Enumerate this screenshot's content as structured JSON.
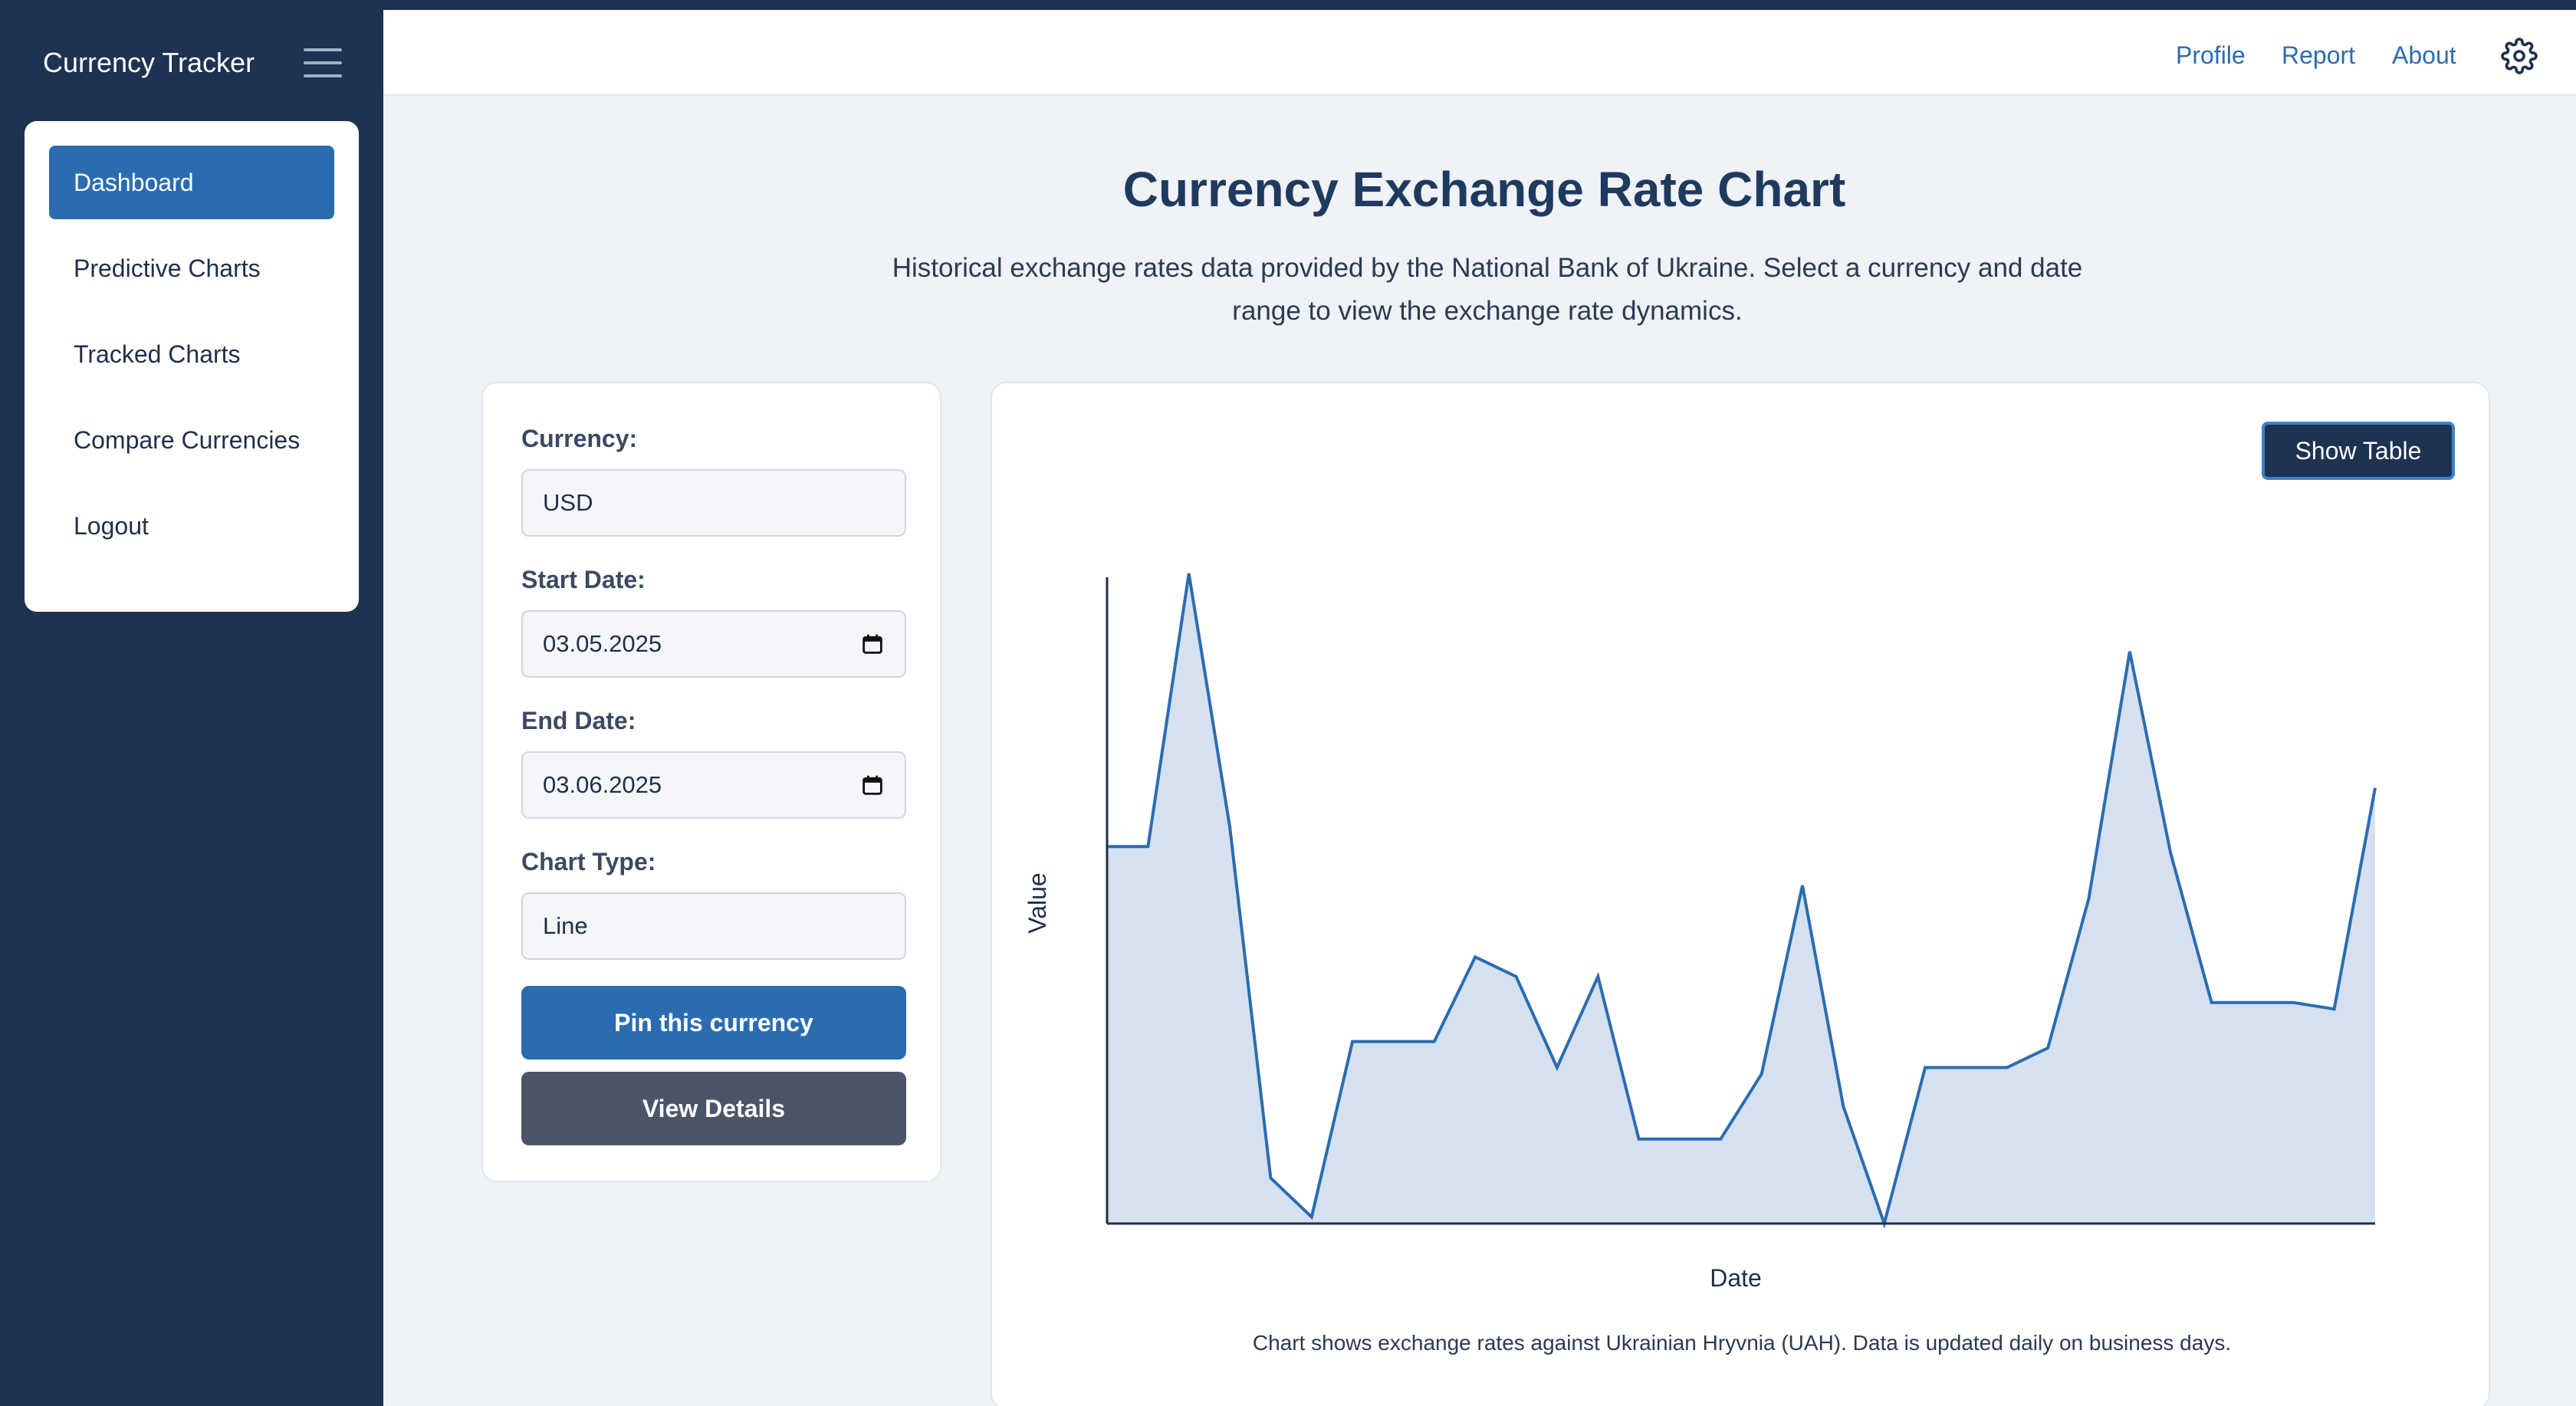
{
  "app": {
    "title": "Currency Tracker"
  },
  "sidebar": {
    "items": [
      {
        "label": "Dashboard",
        "active": true
      },
      {
        "label": "Predictive Charts",
        "active": false
      },
      {
        "label": "Tracked Charts",
        "active": false
      },
      {
        "label": "Compare Currencies",
        "active": false
      },
      {
        "label": "Logout",
        "active": false
      }
    ]
  },
  "header": {
    "links": {
      "profile": "Profile",
      "report": "Report",
      "about": "About"
    },
    "settings_icon": "gear-icon"
  },
  "main": {
    "title": "Currency Exchange Rate Chart",
    "description": "Historical exchange rates data provided by the National Bank of Ukraine. Select a currency and date range to view the exchange rate dynamics."
  },
  "controls": {
    "currency_label": "Currency:",
    "currency_value": "USD",
    "start_label": "Start Date:",
    "start_value": "03.05.2025",
    "end_label": "End Date:",
    "end_value": "03.06.2025",
    "chart_type_label": "Chart Type:",
    "chart_type_value": "Line",
    "pin_button": "Pin this currency",
    "view_button": "View Details"
  },
  "chart": {
    "show_table_button": "Show Table",
    "note": "Chart shows exchange rates against Ukrainian Hryvnia (UAH). Data is updated daily on business days."
  },
  "colors": {
    "sidebar_bg": "#1e3252",
    "accent": "#2b6cb0",
    "secondary_button": "#4a5568",
    "line": "#2b6cb0",
    "area_fill": "#d5e1ef"
  },
  "chart_data": {
    "type": "area",
    "title": "",
    "xlabel": "Date",
    "ylabel": "Value",
    "grid": false,
    "legend": "none",
    "x_ticks_shown": false,
    "y_ticks_shown": false,
    "ylim": [
      0,
      100
    ],
    "x": [
      1,
      2,
      3,
      4,
      5,
      6,
      7,
      8,
      9,
      10,
      11,
      12,
      13,
      14,
      15,
      16,
      17,
      18,
      19,
      20,
      21,
      22,
      23,
      24,
      25,
      26,
      27,
      28,
      29,
      30,
      31,
      32
    ],
    "series": [
      {
        "values": [
          58,
          58,
          100,
          61,
          7,
          1,
          28,
          28,
          28,
          41,
          38,
          24,
          38,
          13,
          13,
          13,
          23,
          52,
          18,
          0,
          24,
          24,
          24,
          27,
          50,
          88,
          57,
          34,
          34,
          34,
          33,
          67
        ]
      }
    ]
  }
}
